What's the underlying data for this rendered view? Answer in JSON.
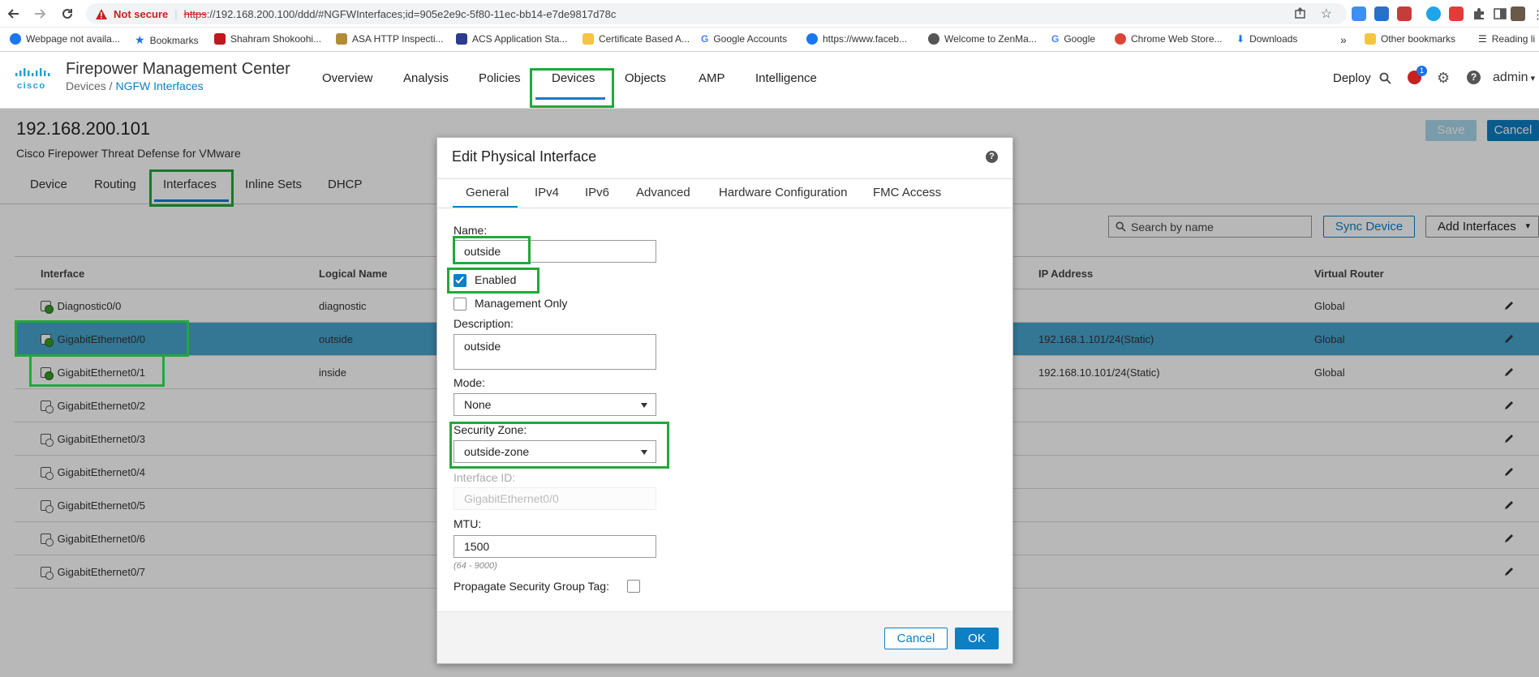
{
  "browser": {
    "security_label": "Not secure",
    "url_scheme": "https",
    "url_rest": "://192.168.200.100/ddd/#NGFWInterfaces;id=905e2e9c-5f80-11ec-bb14-e7de9817d78c",
    "bookmarks": [
      "Webpage not availa...",
      "Bookmarks",
      "Shahram Shokoohi...",
      "ASA HTTP Inspecti...",
      "ACS Application Sta...",
      "Certificate Based A...",
      "Google Accounts",
      "https://www.faceb...",
      "Welcome to ZenMa...",
      "Google",
      "Chrome Web Store...",
      "Downloads"
    ],
    "overflow": "»",
    "other_bookmarks": "Other bookmarks",
    "reading_list": "Reading li"
  },
  "header": {
    "brand": "cisco",
    "product": "Firepower Management Center",
    "breadcrumb_parent": "Devices / ",
    "breadcrumb_current": "NGFW Interfaces",
    "nav": [
      "Overview",
      "Analysis",
      "Policies",
      "Devices",
      "Objects",
      "AMP",
      "Intelligence"
    ],
    "deploy": "Deploy",
    "alert_count": "1",
    "user": "admin"
  },
  "device": {
    "ip": "192.168.200.101",
    "model": "Cisco Firepower Threat Defense for VMware",
    "save": "Save",
    "cancel": "Cancel",
    "tabs": [
      "Device",
      "Routing",
      "Interfaces",
      "Inline Sets",
      "DHCP"
    ]
  },
  "toolbar": {
    "search_placeholder": "Search by name",
    "sync": "Sync Device",
    "add": "Add Interfaces"
  },
  "table": {
    "headers": [
      "Interface",
      "Logical Name",
      "IP Address",
      "Virtual Router"
    ],
    "rows": [
      {
        "iface": "Diagnostic0/0",
        "name": "diagnostic",
        "ip": "",
        "vr": "Global"
      },
      {
        "iface": "GigabitEthernet0/0",
        "name": "outside",
        "ip": "192.168.1.101/24(Static)",
        "vr": "Global"
      },
      {
        "iface": "GigabitEthernet0/1",
        "name": "inside",
        "ip": "192.168.10.101/24(Static)",
        "vr": "Global"
      },
      {
        "iface": "GigabitEthernet0/2",
        "name": "",
        "ip": "",
        "vr": ""
      },
      {
        "iface": "GigabitEthernet0/3",
        "name": "",
        "ip": "",
        "vr": ""
      },
      {
        "iface": "GigabitEthernet0/4",
        "name": "",
        "ip": "",
        "vr": ""
      },
      {
        "iface": "GigabitEthernet0/5",
        "name": "",
        "ip": "",
        "vr": ""
      },
      {
        "iface": "GigabitEthernet0/6",
        "name": "",
        "ip": "",
        "vr": ""
      },
      {
        "iface": "GigabitEthernet0/7",
        "name": "",
        "ip": "",
        "vr": ""
      }
    ]
  },
  "dialog": {
    "title": "Edit Physical Interface",
    "help": "?",
    "tabs": [
      "General",
      "IPv4",
      "IPv6",
      "Advanced",
      "Hardware Configuration",
      "FMC Access"
    ],
    "name_label": "Name:",
    "name_value": "outside",
    "enabled_label": "Enabled",
    "mgmt_label": "Management Only",
    "desc_label": "Description:",
    "desc_value": "outside",
    "mode_label": "Mode:",
    "mode_value": "None",
    "zone_label": "Security Zone:",
    "zone_value": "outside-zone",
    "ifid_label": "Interface ID:",
    "ifid_value": "GigabitEthernet0/0",
    "mtu_label": "MTU:",
    "mtu_value": "1500",
    "mtu_range": "(64 - 9000)",
    "sgt_label": "Propagate Security Group Tag:",
    "cancel": "Cancel",
    "ok": "OK"
  },
  "colors": {
    "accent": "#0d7fc4",
    "highlight_box": "#22a83a",
    "selected_row": "#47a6cf",
    "warning": "#c5221f"
  }
}
